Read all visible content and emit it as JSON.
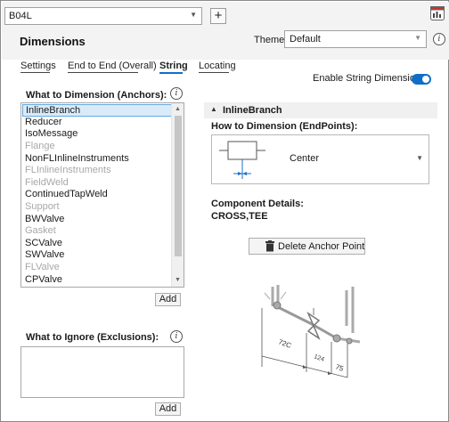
{
  "header": {
    "document_combo_value": "B04L",
    "title": "Dimensions",
    "theme_label": "Theme:",
    "theme_value": "Default"
  },
  "tabs": [
    {
      "label": "Settings",
      "active": false
    },
    {
      "label": "End to End (Overall)",
      "active": false
    },
    {
      "label": "String",
      "active": true
    },
    {
      "label": "Locating",
      "active": false
    }
  ],
  "enable_string_label": "Enable String Dimensions:",
  "enable_string_on": true,
  "anchors": {
    "title": "What to Dimension (Anchors):",
    "items": [
      {
        "label": "InlineBranch",
        "selected": true,
        "enabled": true
      },
      {
        "label": "Reducer",
        "selected": false,
        "enabled": true
      },
      {
        "label": "IsoMessage",
        "selected": false,
        "enabled": true
      },
      {
        "label": "Flange",
        "selected": false,
        "enabled": false
      },
      {
        "label": "NonFLInlineInstruments",
        "selected": false,
        "enabled": true
      },
      {
        "label": "FLInlineInstruments",
        "selected": false,
        "enabled": false
      },
      {
        "label": "FieldWeld",
        "selected": false,
        "enabled": false
      },
      {
        "label": "ContinuedTapWeld",
        "selected": false,
        "enabled": true
      },
      {
        "label": "Support",
        "selected": false,
        "enabled": false
      },
      {
        "label": "BWValve",
        "selected": false,
        "enabled": true
      },
      {
        "label": "Gasket",
        "selected": false,
        "enabled": false
      },
      {
        "label": "SCValve",
        "selected": false,
        "enabled": true
      },
      {
        "label": "SWValve",
        "selected": false,
        "enabled": true
      },
      {
        "label": "FLValve",
        "selected": false,
        "enabled": false
      },
      {
        "label": "CPValve",
        "selected": false,
        "enabled": true
      }
    ],
    "add_label": "Add"
  },
  "exclusions": {
    "title": "What to Ignore (Exclusions):",
    "add_label": "Add"
  },
  "detail": {
    "section_title": "InlineBranch",
    "how_label": "How to Dimension (EndPoints):",
    "endpoint_value": "Center",
    "component_details_label": "Component Details:",
    "component_details_value": "CROSS,TEE",
    "delete_label": "Delete Anchor Point"
  },
  "preview_dims": [
    "72C",
    "124",
    "75"
  ],
  "colors": {
    "accent": "#0f6fc6",
    "selection_bg": "#d9ebf9",
    "disabled_text": "#a8a8a8"
  }
}
